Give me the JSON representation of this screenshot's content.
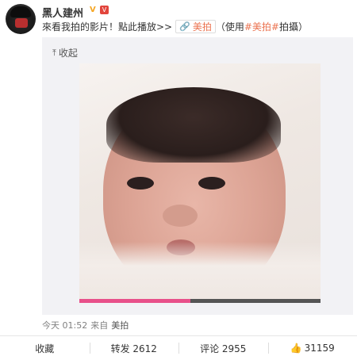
{
  "post": {
    "username": "黑人建州",
    "verified_badge": "V",
    "rank_badge": "V",
    "text_prefix": "來看我拍的影片！點此播放>>",
    "link_label": "美拍",
    "text_suffix_open": "（使用",
    "hashtag": "#美拍#",
    "text_suffix_close": "拍攝）",
    "collapse_label": "收起",
    "video_progress_percent": 46,
    "timestamp": "今天 01:52",
    "source_prefix": "来自",
    "source_app": "美拍"
  },
  "actions": {
    "favorite": "收藏",
    "repost": "转发 2612",
    "comment": "评论 2955",
    "like": "31159"
  },
  "icons": {
    "link": "paperclip-icon",
    "collapse": "arrow-up-icon",
    "like": "thumbs-up-icon"
  },
  "colors": {
    "link_accent": "#eb7350",
    "progress": "#e8508a",
    "verified": "#f5a623"
  }
}
